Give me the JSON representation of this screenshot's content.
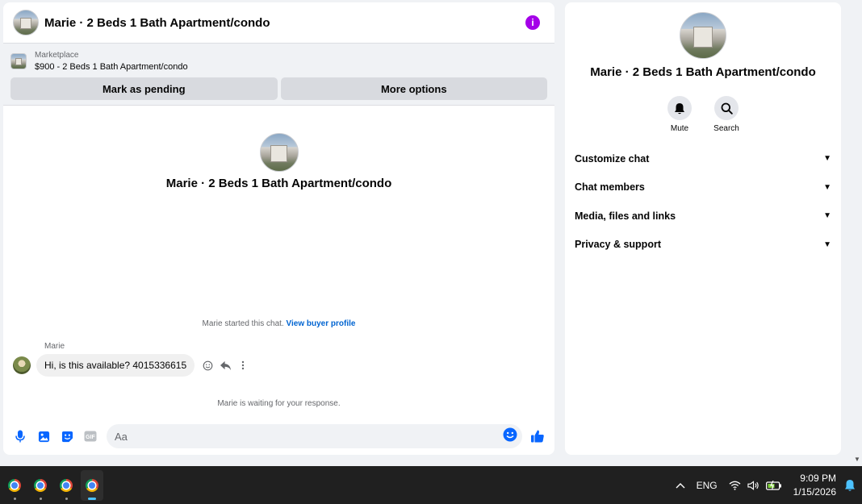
{
  "chat": {
    "title": "Marie · 2 Beds 1 Bath Apartment/condo",
    "marketplace_label": "Marketplace",
    "listing": "$900 - 2 Beds 1 Bath Apartment/condo",
    "mark_pending_label": "Mark as pending",
    "more_options_label": "More options",
    "intro_title": "Marie · 2 Beds 1 Bath Apartment/condo",
    "started_text": "Marie started this chat.",
    "view_buyer_profile": "View buyer profile",
    "sender_name": "Marie",
    "message": "Hi, is this available? 4015336615",
    "waiting_text": "Marie is waiting for your response.",
    "composer_placeholder": "Aa"
  },
  "info": {
    "title": "Marie · 2 Beds 1 Bath Apartment/condo",
    "mute_label": "Mute",
    "search_label": "Search",
    "sections": [
      {
        "label": "Customize chat"
      },
      {
        "label": "Chat members"
      },
      {
        "label": "Media, files and links"
      },
      {
        "label": "Privacy & support"
      }
    ]
  },
  "taskbar": {
    "language": "ENG",
    "time": "9:09 PM",
    "date": "1/15/2026"
  },
  "colors": {
    "accent": "#0866ff",
    "info_icon": "#a400e8",
    "link": "#0064d1"
  }
}
